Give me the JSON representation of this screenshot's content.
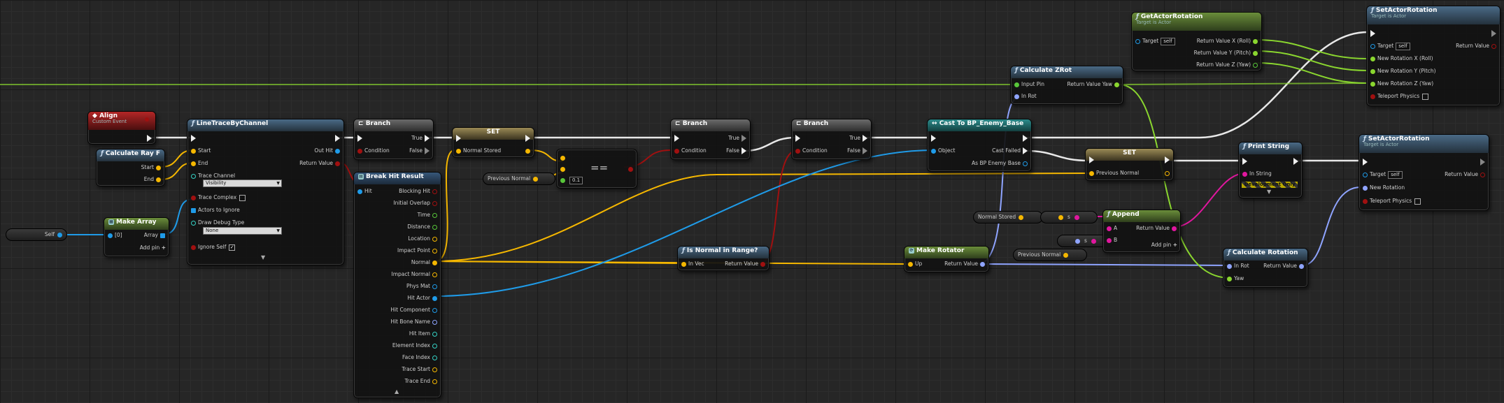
{
  "nodes": {
    "align": {
      "title": "Align",
      "subtitle": "Custom Event"
    },
    "calc_ray": {
      "title": "Calculate Ray F",
      "start": "Start",
      "end": "End"
    },
    "make_array": {
      "title": "Make Array",
      "item0": "[0]",
      "array": "Array",
      "add_pin": "Add pin"
    },
    "self_var": {
      "label": "Self"
    },
    "line_trace": {
      "title": "LineTraceByChannel",
      "start": "Start",
      "end": "End",
      "trace_channel": "Trace Channel",
      "trace_channel_value": "Visibility",
      "trace_complex": "Trace Complex",
      "actors_to_ignore": "Actors to Ignore",
      "draw_debug_type": "Draw Debug Type",
      "draw_debug_value": "None",
      "ignore_self": "Ignore Self",
      "out_hit": "Out Hit",
      "return_value": "Return Value"
    },
    "branch1": {
      "title": "Branch",
      "condition": "Condition",
      "true": "True",
      "false": "False"
    },
    "break_hit": {
      "title": "Break Hit Result",
      "hit": "Hit",
      "pins": [
        "Blocking Hit",
        "Initial Overlap",
        "Time",
        "Distance",
        "Location",
        "Impact Point",
        "Normal",
        "Impact Normal",
        "Phys Mat",
        "Hit Actor",
        "Hit Component",
        "Hit Bone Name",
        "Hit Item",
        "Element Index",
        "Face Index",
        "Trace Start",
        "Trace End"
      ]
    },
    "set1": {
      "title": "SET",
      "var": "Normal Stored"
    },
    "prev_normal_var1": {
      "label": "Previous Normal"
    },
    "equal": {
      "symbol": "==",
      "tolerance": "0.1"
    },
    "branch2": {
      "title": "Branch",
      "condition": "Condition",
      "true": "True",
      "false": "False"
    },
    "branch3": {
      "title": "Branch",
      "condition": "Condition",
      "true": "True",
      "false": "False"
    },
    "is_normal_range": {
      "title": "Is Normal in Range?",
      "in_vec": "In Vec",
      "return_value": "Return Value"
    },
    "cast": {
      "title": "Cast To BP_Enemy_Base",
      "object": "Object",
      "cast_failed": "Cast Failed",
      "as_enemy": "As BP Enemy Base"
    },
    "calc_zrot": {
      "title": "Calculate ZRot",
      "input_pin": "Input Pin",
      "in_rot": "In Rot",
      "return_value_yaw": "Return Value Yaw"
    },
    "get_actor_rot": {
      "title": "GetActorRotation",
      "subtitle": "Target is Actor",
      "target": "Target",
      "self": "self",
      "rx": "Return Value X (Roll)",
      "ry": "Return Value Y (Pitch)",
      "rz": "Return Value Z (Yaw)"
    },
    "set_actor_rot1": {
      "title": "SetActorRotation",
      "subtitle": "Target is Actor",
      "target": "Target",
      "self": "self",
      "nrx": "New Rotation X (Roll)",
      "nry": "New Rotation Y (Pitch)",
      "nrz": "New Rotation Z (Yaw)",
      "teleport": "Teleport Physics",
      "return_value": "Return Value"
    },
    "set2": {
      "title": "SET",
      "var": "Previous Normal"
    },
    "normal_stored_var": {
      "label": "Normal Stored"
    },
    "prev_normal_var2": {
      "label": "Previous Normal"
    },
    "conv1": {
      "label": "s"
    },
    "conv2": {
      "label": "s"
    },
    "make_rotator": {
      "title": "Make Rotator",
      "up": "Up",
      "return_value": "Return Value"
    },
    "append": {
      "title": "Append",
      "a": "A",
      "b": "B",
      "return_value": "Return Value",
      "add_pin": "Add pin"
    },
    "print_string": {
      "title": "Print String",
      "in_string": "In String",
      "dev_only": "Development Only"
    },
    "calc_rotation": {
      "title": "Calculate Rotation",
      "in_rot": "In Rot",
      "yaw": "Yaw",
      "return_value": "Return Value"
    },
    "set_actor_rot2": {
      "title": "SetActorRotation",
      "subtitle": "Target is Actor",
      "target": "Target",
      "self": "self",
      "new_rotation": "New Rotation",
      "teleport": "Teleport Physics",
      "return_value": "Return Value"
    }
  },
  "colors": {
    "exec": "#ffffff",
    "bool": "#a01010",
    "vector": "#f5b700",
    "object": "#1f9be8",
    "float": "#8ad62f",
    "string": "#e0179e",
    "rotator": "#8fa4ff",
    "struct": "#35d1c4"
  }
}
